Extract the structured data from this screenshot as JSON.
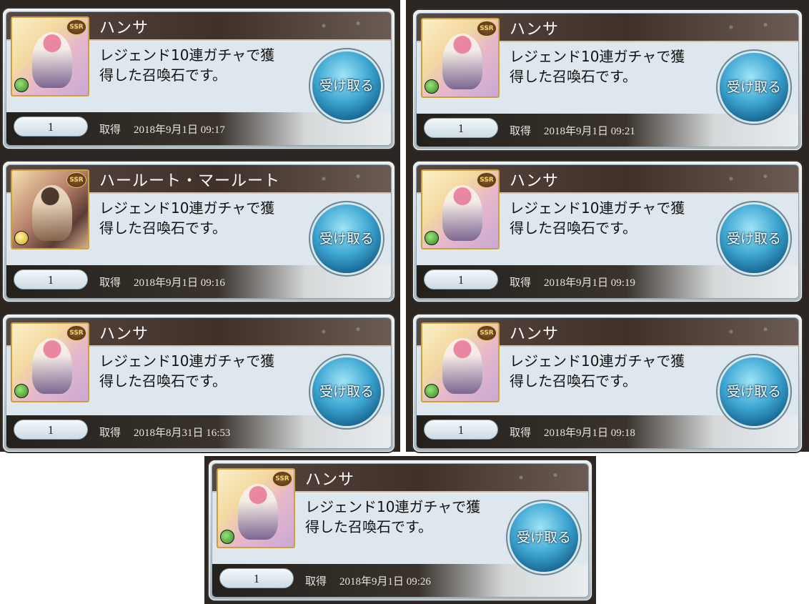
{
  "button_label": "受け取る",
  "acquired_label": "取得",
  "rarity_badge": "SSR",
  "cards": [
    {
      "name": "ハンサ",
      "desc_line1": "レジェンド10連ガチャで獲",
      "desc_line2": "得した召喚石です。",
      "quantity": "1",
      "date": "2018年9月1日 09:17",
      "element": "wind-element-icon"
    },
    {
      "name": "ハンサ",
      "desc_line1": "レジェンド10連ガチャで獲",
      "desc_line2": "得した召喚石です。",
      "quantity": "1",
      "date": "2018年9月1日 09:21",
      "element": "wind-element-icon"
    },
    {
      "name": "ハールート・マールート",
      "desc_line1": "レジェンド10連ガチャで獲",
      "desc_line2": "得した召喚石です。",
      "quantity": "1",
      "date": "2018年9月1日 09:16",
      "element": "light-element-icon"
    },
    {
      "name": "ハンサ",
      "desc_line1": "レジェンド10連ガチャで獲",
      "desc_line2": "得した召喚石です。",
      "quantity": "1",
      "date": "2018年9月1日 09:19",
      "element": "wind-element-icon"
    },
    {
      "name": "ハンサ",
      "desc_line1": "レジェンド10連ガチャで獲",
      "desc_line2": "得した召喚石です。",
      "quantity": "1",
      "date": "2018年8月31日 16:53",
      "element": "wind-element-icon"
    },
    {
      "name": "ハンサ",
      "desc_line1": "レジェンド10連ガチャで獲",
      "desc_line2": "得した召喚石です。",
      "quantity": "1",
      "date": "2018年9月1日 09:18",
      "element": "wind-element-icon"
    },
    {
      "name": "ハンサ",
      "desc_line1": "レジェンド10連ガチャで獲",
      "desc_line2": "得した召喚石です。",
      "quantity": "1",
      "date": "2018年9月1日 09:26",
      "element": "wind-element-icon"
    }
  ]
}
